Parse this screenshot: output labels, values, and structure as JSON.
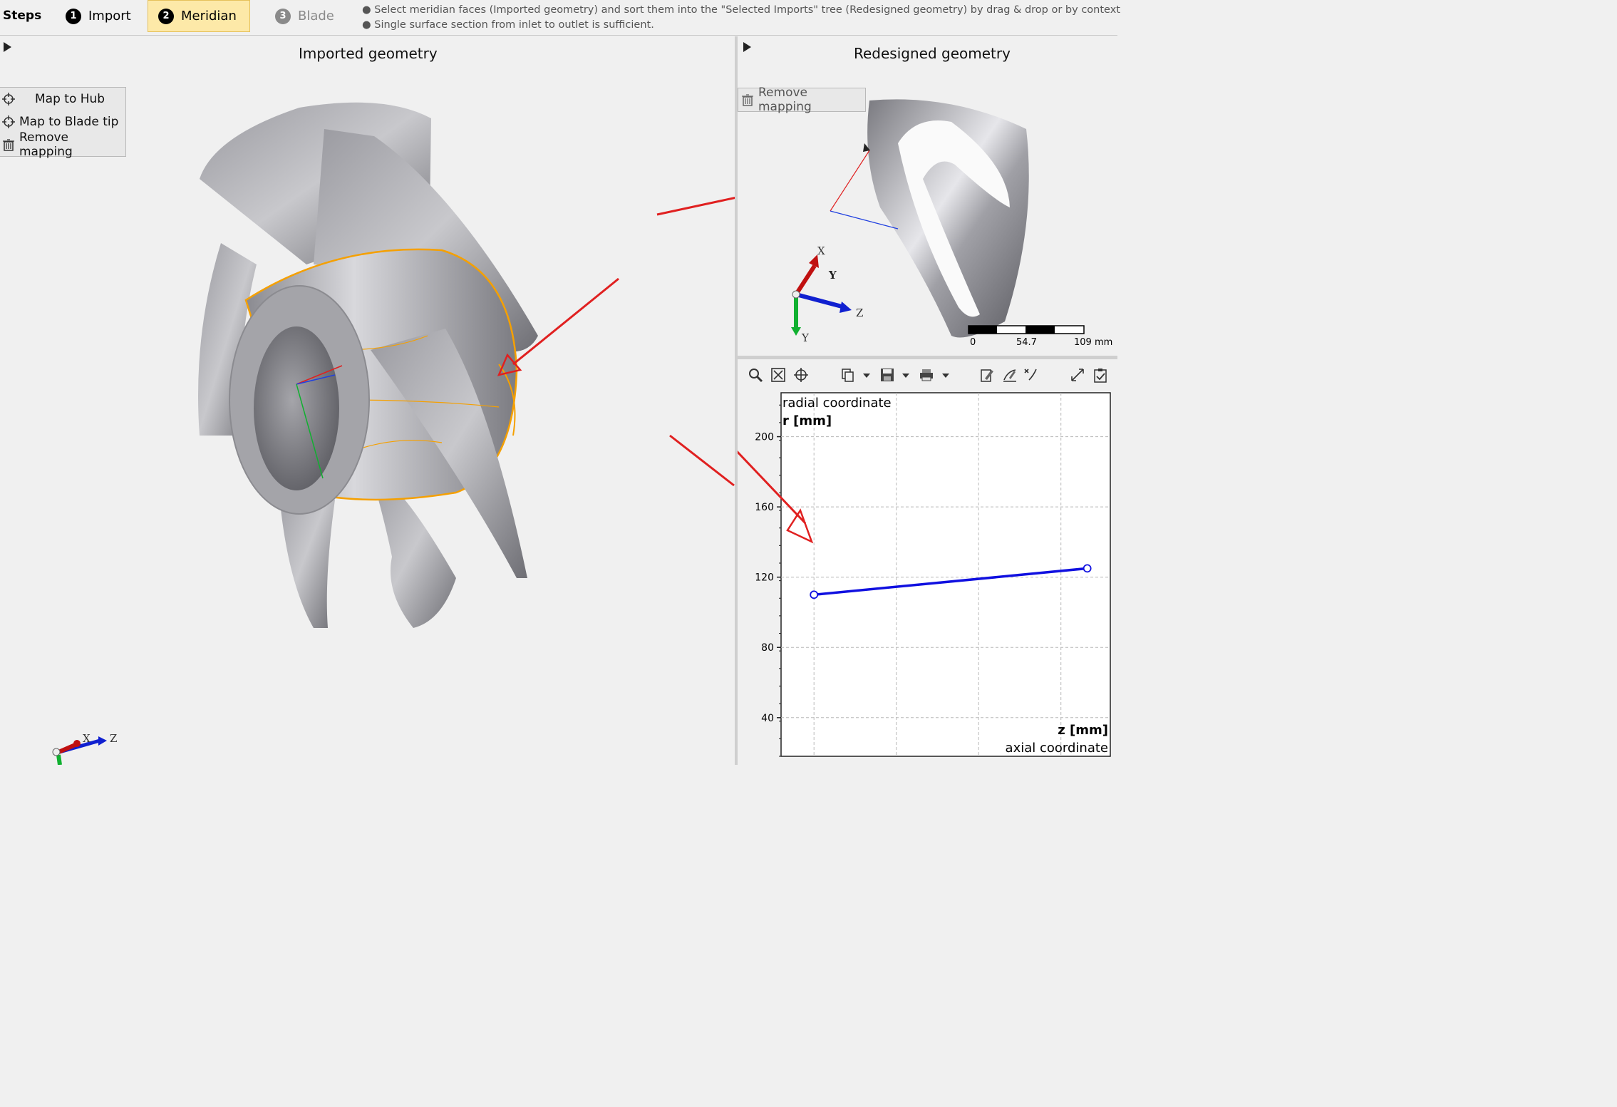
{
  "stepbar": {
    "label": "Steps",
    "steps": [
      {
        "num": "1",
        "label": "Import"
      },
      {
        "num": "2",
        "label": "Meridian"
      },
      {
        "num": "3",
        "label": "Blade"
      }
    ],
    "hints": [
      "● Select meridian faces (Imported geometry) and sort them into the \"Selected Imports\" tree (Redesigned geometry) by drag & drop or by context",
      "● Single surface section from inlet to outlet is sufficient."
    ]
  },
  "left_panel": {
    "title": "Imported geometry",
    "menu": [
      {
        "label": "Map to Hub",
        "icon": "crosshair-icon"
      },
      {
        "label": "Map to Blade tip",
        "icon": "crosshair-icon"
      },
      {
        "label": "Remove mapping",
        "icon": "trash-icon"
      }
    ],
    "triad": {
      "x": "X",
      "z": "Z"
    }
  },
  "right_top_panel": {
    "title": "Redesigned geometry",
    "menu_item": "Remove mapping",
    "triad": {
      "x": "X",
      "y": "Y",
      "z": "Z",
      "y2": "Y"
    },
    "scale": {
      "labels": [
        "0",
        "54.7",
        "109 mm"
      ]
    }
  },
  "chart_toolbar": {
    "icons": [
      "zoom-icon",
      "fit-icon",
      "crosshair-icon",
      "copy-icon",
      "save-icon",
      "print-icon",
      "edit-icon",
      "edit-curve-icon",
      "edit-point-icon",
      "scale-icon",
      "checklist-icon"
    ]
  },
  "colors": {
    "accent": "#fde9a8",
    "highlight_edges": "#f5a000",
    "arrow": "#e02020",
    "series": "#1010e0"
  },
  "chart_data": {
    "type": "line",
    "ylabel_text": "radial coordinate",
    "ylabel_unit": "r [mm]",
    "xlabel_unit": "z [mm]",
    "xlabel_text": "axial coordinate",
    "yticks": [
      40,
      80,
      120,
      160,
      200
    ],
    "ylim": [
      18,
      225
    ],
    "xlim": [
      0,
      10
    ],
    "grid": true,
    "series": [
      {
        "x": [
          1,
          9.3
        ],
        "y": [
          110,
          125
        ]
      }
    ]
  }
}
